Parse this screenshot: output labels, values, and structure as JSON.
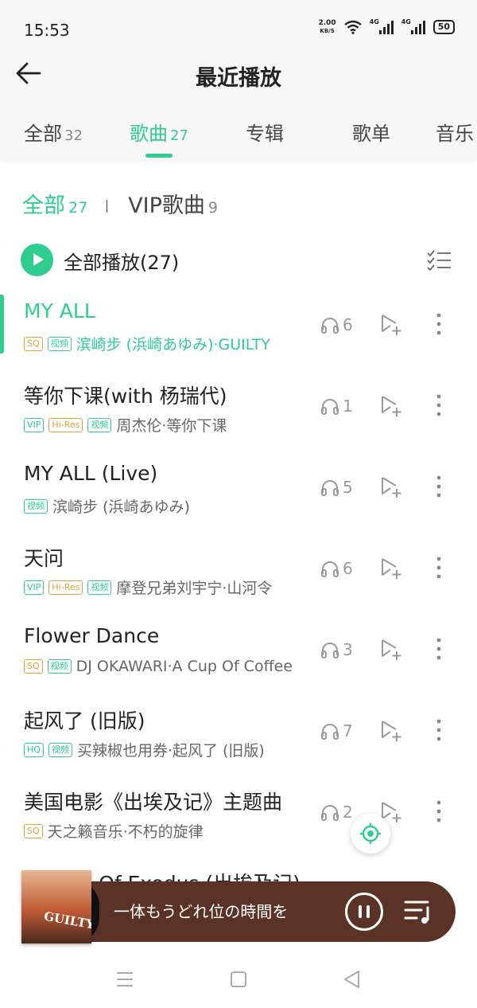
{
  "status_bar": {
    "time": "15:53",
    "net_speed_value": "2.00",
    "net_speed_unit": "KB/S",
    "signal_1": "4G",
    "signal_2": "4G",
    "battery": "50"
  },
  "header": {
    "title": "最近播放",
    "back_icon": "arrow-left-icon"
  },
  "tabs": [
    {
      "label": "全部",
      "count": "32"
    },
    {
      "label": "歌曲",
      "count": "27"
    },
    {
      "label": "专辑",
      "count": ""
    },
    {
      "label": "歌单",
      "count": ""
    },
    {
      "label": "音乐",
      "count": ""
    }
  ],
  "active_tab": "歌曲",
  "filters": [
    {
      "label": "全部",
      "count": "27"
    },
    {
      "label": "VIP歌曲",
      "count": "9"
    }
  ],
  "play_all": {
    "label": "全部播放(27)"
  },
  "songs": [
    {
      "title": "MY ALL",
      "badges": [
        "SQ",
        "视频"
      ],
      "artist": "滨崎步 (浜崎あゆみ)·GUILTY",
      "plays": "6",
      "active": true
    },
    {
      "title": "等你下课(with 杨瑞代)",
      "badges": [
        "VIP",
        "Hi-Res",
        "视频"
      ],
      "artist": "周杰伦·等你下课",
      "plays": "1"
    },
    {
      "title": "MY ALL (Live)",
      "badges": [
        "视频"
      ],
      "artist": "滨崎步 (浜崎あゆみ)",
      "plays": "5"
    },
    {
      "title": "天问",
      "badges": [
        "VIP",
        "Hi-Res",
        "视频"
      ],
      "artist": "摩登兄弟刘宇宁·山河令",
      "plays": "6"
    },
    {
      "title": "Flower Dance",
      "badges": [
        "SQ",
        "视频"
      ],
      "artist": "DJ OKAWARI·A Cup Of Coffee",
      "plays": "3"
    },
    {
      "title": "起风了 (旧版)",
      "badges": [
        "HQ",
        "视频"
      ],
      "artist": "买辣椒也用券·起风了 (旧版)",
      "plays": "7"
    },
    {
      "title": "美国电影《出埃及记》主题曲",
      "badges": [
        "SQ"
      ],
      "artist": "天之籁音乐·不朽的旋律",
      "plays": "2"
    },
    {
      "title": "Theme Of Exodus (出埃及记)",
      "badges": [],
      "artist": "",
      "plays": ""
    }
  ],
  "mini_player": {
    "now_playing": "一体もうどれ位の時間を",
    "album_word": "GUILTY"
  },
  "colors": {
    "accent": "#2ecc8f",
    "badge_gold": "#e3a133",
    "player_bg": "#5a3326"
  }
}
